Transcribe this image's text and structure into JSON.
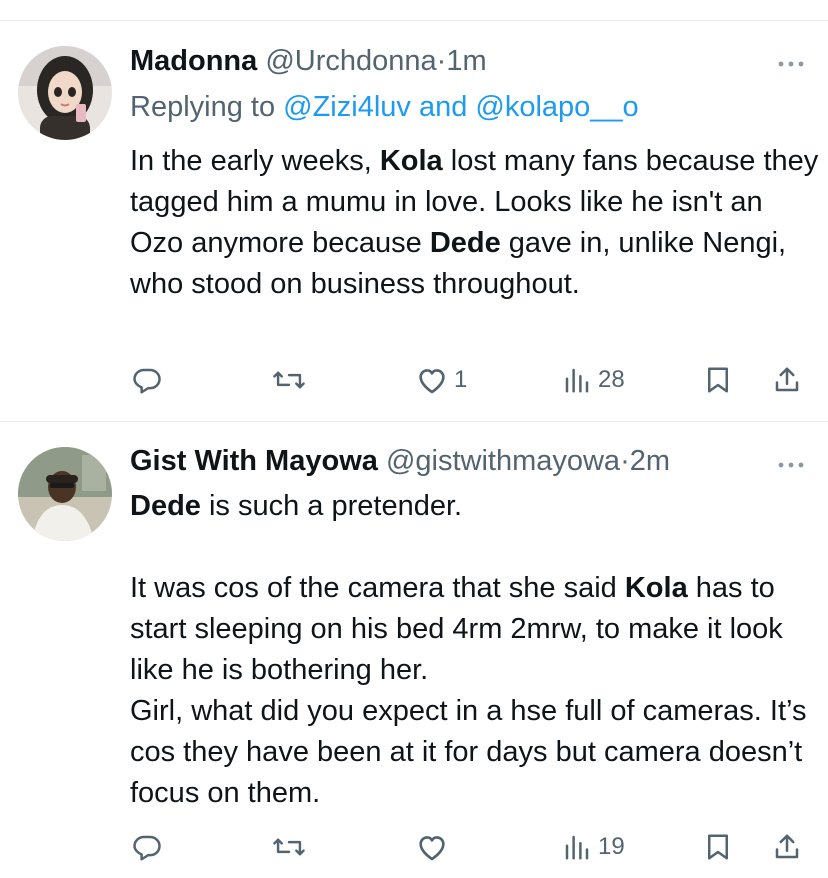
{
  "tweets": [
    {
      "display_name": "Madonna",
      "handle": "@Urchdonna",
      "separator": "·",
      "time": "1m",
      "replying_prefix": "Replying to ",
      "replying_mention_1": "@Zizi4luv",
      "replying_and": " and ",
      "replying_mention_2": "@kolapo__o",
      "body": {
        "s1": "In the early weeks, ",
        "b1": "Kola",
        "s2": " lost many fans because they tagged him a mumu in love. Looks like he isn't an Ozo anymore because ",
        "b2": "Dede",
        "s3": " gave in, unlike Nengi, who stood on business throughout."
      },
      "likes": "1",
      "views": "28",
      "replies": "",
      "retweets": ""
    },
    {
      "display_name": "Gist With Mayowa",
      "handle": "@gistwithmayowa",
      "separator": "·",
      "time": "2m",
      "body": {
        "p1_b1": "Dede",
        "p1_s1": " is such a pretender.",
        "p2_s1": "It was cos of the camera that she said ",
        "p2_b1": "Kola",
        "p2_s2": " has to start sleeping on his bed 4rm 2mrw, to make it look like he is bothering her.",
        "p3_s1": "Girl, what did you expect in a hse full of cameras. It’s cos they have been at it for days but camera doesn’t focus on them."
      },
      "likes": "",
      "views": "19",
      "replies": "",
      "retweets": ""
    }
  ],
  "icons": {
    "reply": "reply-icon",
    "retweet": "retweet-icon",
    "like": "heart-icon",
    "views": "views-icon",
    "bookmark": "bookmark-icon",
    "share": "share-icon",
    "more": "more-icon"
  },
  "colors": {
    "text": "#0f1419",
    "secondary": "#536471",
    "mention": "#1d9bf0",
    "divider": "#e7e9ea"
  }
}
